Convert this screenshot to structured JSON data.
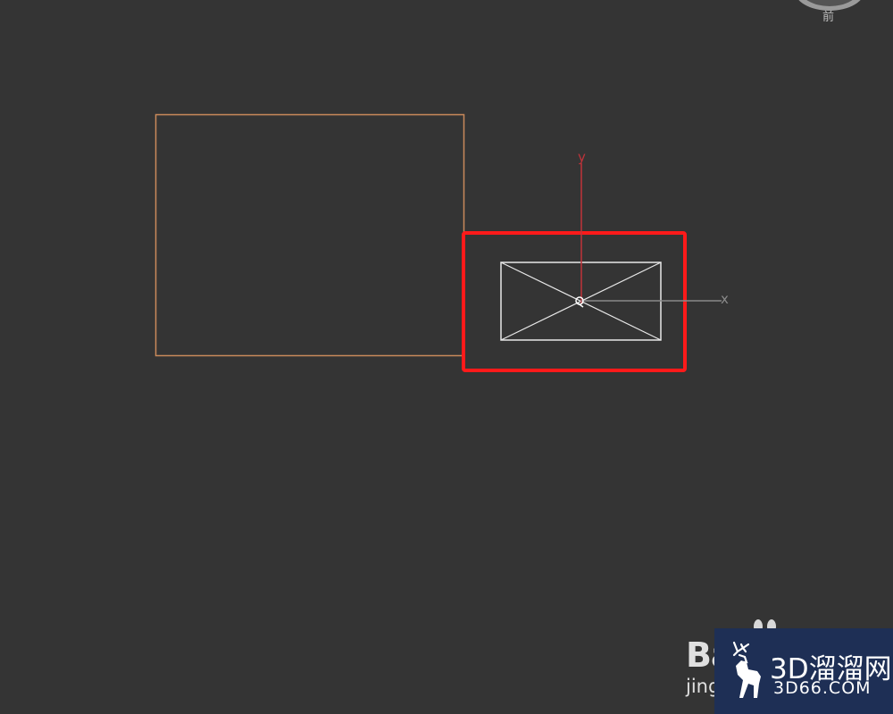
{
  "viewport": {
    "background": "#343434"
  },
  "viewcube": {
    "label": "前"
  },
  "scene": {
    "outer_shape_color": "#c9895a",
    "highlight_color": "#ff1a1a",
    "camera_icon_color": "#e8e8e8",
    "gizmo": {
      "y_axis_label": "y",
      "x_axis_label": "x",
      "y_axis_color": "#c0333a",
      "x_axis_color": "#8a8a8a"
    }
  },
  "watermark": {
    "baidu_text": "Ba",
    "baidu_sub": "jing",
    "brand_name": "3D溜溜网",
    "brand_domain": "3D66.COM",
    "brand_bg": "#1e2f55"
  }
}
